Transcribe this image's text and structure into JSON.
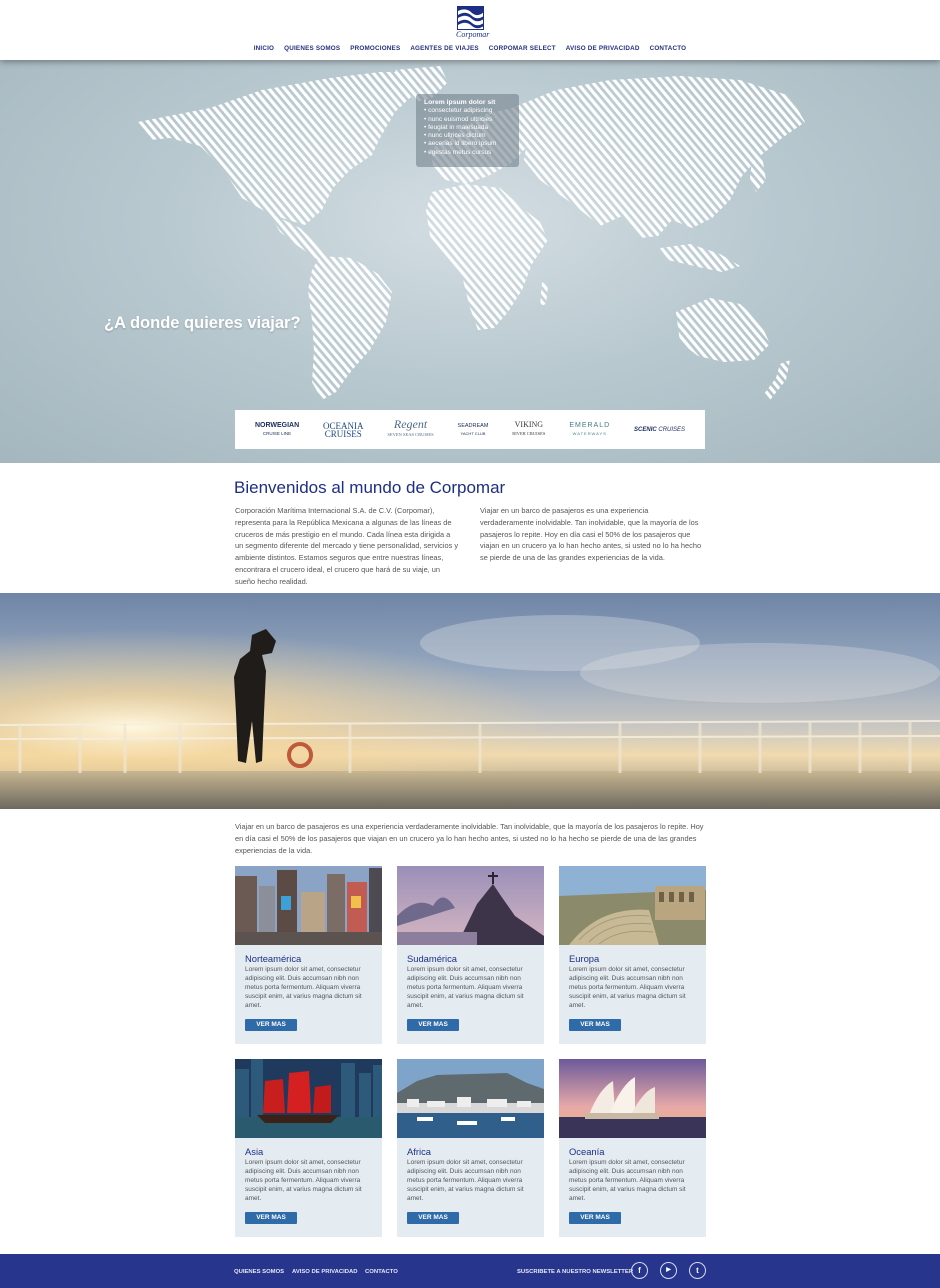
{
  "brand": {
    "logo_text": "Corpomar"
  },
  "nav": {
    "items": [
      "INICIO",
      "QUIENES SOMOS",
      "PROMOCIONES",
      "AGENTES DE VIAJES",
      "CORPOMAR SELECT",
      "AVISO DE PRIVACIDAD",
      "CONTACTO"
    ]
  },
  "hero": {
    "tooltip": {
      "title": "Lorem ipsum dolor sit",
      "items": [
        "• consectetur adipiscing",
        "• nunc euismod ultricies",
        "• feugiat in malesuada",
        "• nunc ultrices dictum",
        "• aecenas id libero ipsum",
        "• egestas metus cursus"
      ]
    },
    "question": "¿A donde quieres viajar?",
    "brands": [
      {
        "name": "NORWEGIAN",
        "sub": "CRUISE LINE"
      },
      {
        "name": "OCEANIA",
        "sub": "CRUISES"
      },
      {
        "name": "Regent",
        "sub": "SEVEN SEAS CRUISES"
      },
      {
        "name": "SEADREAM",
        "sub": "YACHT CLUB"
      },
      {
        "name": "VIKING",
        "sub": "RIVER CRUISES"
      },
      {
        "name": "EMERALD",
        "sub": "WATERWAYS"
      },
      {
        "name": "SCENIC",
        "sub": "CRUISES"
      }
    ]
  },
  "welcome": {
    "title": "Bienvenidos al mundo de Corpomar",
    "col1": "Corporación Marítima Internacional S.A. de C.V. (Corpomar), representa para la República Mexicana a algunas de las líneas de cruceros de más prestigio en el mundo. Cada línea esta dirigida a un segmento diferente del mercado y tiene personalidad, servicios y ambiente distintos. Estamos seguros que entre nuestras líneas, encontrara el crucero ideal, el crucero que hará de su viaje, un sueño hecho realidad.",
    "col2": "Viajar en un barco de pasajeros es una experiencia verdaderamente inolvidable. Tan inolvidable, que la mayoría de los pasajeros lo repite. Hoy en día casi el 50% de los pasajeros que viajan en un crucero ya lo han hecho antes, si usted no lo ha hecho se pierde de una de las grandes experiencias de la vida."
  },
  "intro": "Viajar en un barco de pasajeros es una experiencia verdaderamente inolvidable. Tan inolvidable, que la mayoría de los pasajeros lo repite. Hoy en día casi el 50% de los pasajeros que viajan en un crucero ya lo han hecho antes, si usted no lo ha hecho se pierde de una de las grandes experiencias de la vida.",
  "destinations": [
    {
      "title": "Norteamérica",
      "text": "Lorem ipsum dolor sit amet, consectetur adipiscing elit. Duis accumsan nibh non metus porta fermentum. Aliquam viverra suscipit enim, at varius magna dictum sit amet.",
      "button": "VER MAS"
    },
    {
      "title": "Sudamérica",
      "text": "Lorem ipsum dolor sit amet, consectetur adipiscing elit. Duis accumsan nibh non metus porta fermentum. Aliquam viverra suscipit enim, at varius magna dictum sit amet.",
      "button": "VER MAS"
    },
    {
      "title": "Europa",
      "text": "Lorem ipsum dolor sit amet, consectetur adipiscing elit. Duis accumsan nibh non metus porta fermentum. Aliquam viverra suscipit enim, at varius magna dictum sit amet.",
      "button": "VER MAS"
    },
    {
      "title": "Asia",
      "text": "Lorem ipsum dolor sit amet, consectetur adipiscing elit. Duis accumsan nibh non metus porta fermentum. Aliquam viverra suscipit enim, at varius magna dictum sit amet.",
      "button": "VER MAS"
    },
    {
      "title": "Africa",
      "text": "Lorem ipsum dolor sit amet, consectetur adipiscing elit. Duis accumsan nibh non metus porta fermentum. Aliquam viverra suscipit enim, at varius magna dictum sit amet.",
      "button": "VER MAS"
    },
    {
      "title": "Oceanía",
      "text": "Lorem ipsum dolor sit amet, consectetur adipiscing elit. Duis accumsan nibh non metus porta fermentum. Aliquam viverra suscipit enim, at varius magna dictum sit amet.",
      "button": "VER MAS"
    }
  ],
  "footer": {
    "links": [
      "QUIENES SOMOS",
      "AVISO DE PRIVACIDAD",
      "CONTACTO"
    ],
    "newsletter": "SUSCRIBETE A NUESTRO NEWSLETTER",
    "social": [
      {
        "icon": "facebook-icon",
        "glyph": "f"
      },
      {
        "icon": "youtube-icon",
        "glyph": "▶"
      },
      {
        "icon": "twitter-icon",
        "glyph": "t"
      }
    ]
  },
  "colors": {
    "primary": "#1d2f85",
    "footer": "#27358c",
    "button": "#2f6ba8",
    "card": "#e4ecf2"
  }
}
